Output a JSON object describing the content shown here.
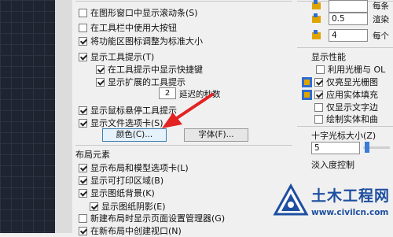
{
  "left_panel": {
    "top_items": [
      {
        "label": "在图形窗口中显示滚动条(S)",
        "checked": false
      },
      {
        "label": "在工具栏中使用大按钮",
        "checked": false
      },
      {
        "label": "将功能区图标调整为标准大小",
        "checked": true
      },
      {
        "label": "显示工具提示(T)",
        "checked": true
      },
      {
        "label": "在工具提示中显示快捷键",
        "checked": true
      },
      {
        "label": "显示扩展的工具提示",
        "checked": true
      }
    ],
    "delay_value": "2",
    "delay_label": "延迟的秒数",
    "mid_items": [
      {
        "label": "显示鼠标悬停工具提示",
        "checked": true
      },
      {
        "label": "显示文件选项卡(S)",
        "checked": true
      }
    ],
    "colors_button": "颜色(C)...",
    "fonts_button": "字体(F)...",
    "layout_group_title": "布局元素",
    "layout_items": [
      {
        "label": "显示布局和模型选项卡(L)",
        "checked": true
      },
      {
        "label": "显示可打印区域(B)",
        "checked": true
      },
      {
        "label": "显示图纸背景(K)",
        "checked": true
      },
      {
        "label": "显示图纸阴影(E)",
        "checked": true
      },
      {
        "label": "新建布局时显示页面设置管理器(G)",
        "checked": false
      },
      {
        "label": "在新布局中创建视口(N)",
        "checked": true
      }
    ]
  },
  "right_panel": {
    "fields": [
      {
        "value": "",
        "label": "每条"
      },
      {
        "value": "0.5",
        "label": "渲染"
      },
      {
        "value": "4",
        "label": "每个"
      }
    ],
    "perf_group_title": "显示性能",
    "perf_items": [
      {
        "label": "利用光栅与 OL",
        "checked": false
      },
      {
        "label": "仅亮显光栅图",
        "checked": true
      },
      {
        "label": "应用实体填充",
        "checked": true
      },
      {
        "label": "仅显示文字边",
        "checked": false
      },
      {
        "label": "绘制实体和曲",
        "checked": false
      }
    ],
    "crosshair_title": "十字光标大小(Z)",
    "crosshair_value": "5",
    "fade_title": "淡入度控制"
  },
  "watermark": {
    "site_name": "土木工程网",
    "url": "www.civilcn.com"
  },
  "colors": {
    "arrow": "#e32222",
    "accent": "#3a7bd5",
    "icon_yellow": "#e0a400"
  }
}
